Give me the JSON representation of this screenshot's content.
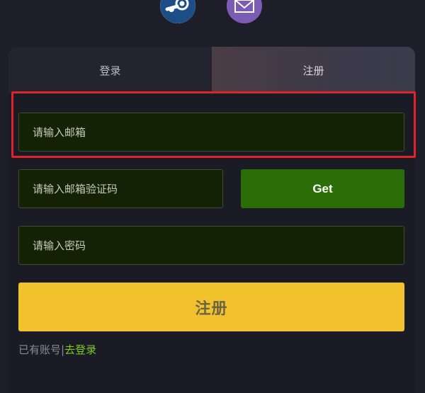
{
  "social": {
    "steam_icon": "steam-icon",
    "mail_icon": "envelope-icon"
  },
  "tabs": [
    {
      "label": "登录",
      "active": false
    },
    {
      "label": "注册",
      "active": true
    }
  ],
  "form": {
    "email_placeholder": "请输入邮箱",
    "code_placeholder": "请输入邮箱验证码",
    "get_code_label": "Get",
    "password_placeholder": "请输入密码",
    "submit_label": "注册"
  },
  "footer": {
    "prompt": "已有账号|",
    "login_link": "去登录"
  },
  "colors": {
    "background": "#1e1e2a",
    "input_bg": "#132204",
    "get_button": "#2b6e07",
    "submit_button": "#f2c12e",
    "link": "#7fcb1a",
    "highlight_border": "#e0242b",
    "steam": "#1b4e86",
    "mail": "#7b5bb3"
  }
}
